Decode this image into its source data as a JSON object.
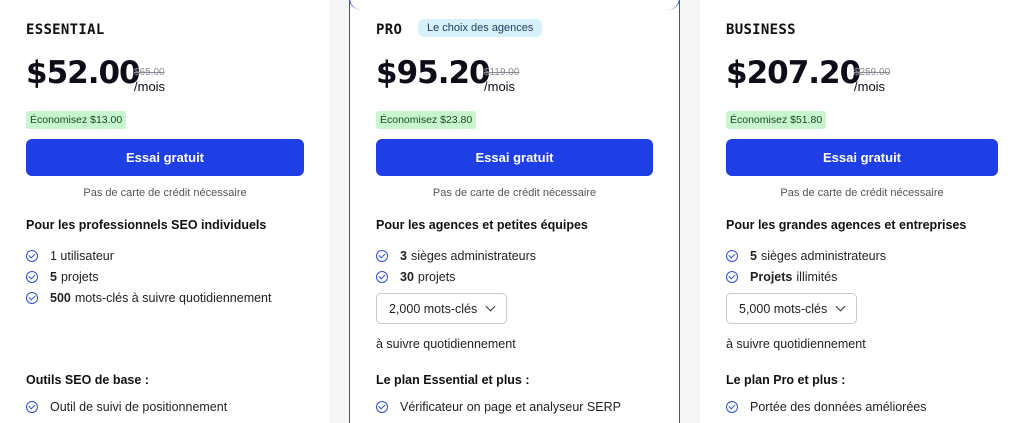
{
  "colors": {
    "accent": "#1f3fe6",
    "save_bg": "#c9f5cf",
    "badge_bg": "#d6f1fb",
    "check": "#2b4fd7"
  },
  "plans": [
    {
      "name": "ESSENTIAL",
      "price": "$52.00",
      "old_price": "$65.00",
      "per": "/mois",
      "save": "Économisez $13.00",
      "cta": "Essai gratuit",
      "no_card": "Pas de carte de crédit nécessaire",
      "audience": "Pour les professionnels SEO individuels",
      "features": [
        {
          "bold": "",
          "text": "1 utilisateur"
        },
        {
          "bold": "5",
          "text": "projets"
        },
        {
          "bold": "500",
          "text": "mots-clés à suivre quotidiennement"
        }
      ],
      "section_title": "Outils SEO de base :",
      "tools": [
        "Outil de suivi de positionnement"
      ]
    },
    {
      "name": "PRO",
      "badge": "Le choix des agences",
      "price": "$95.20",
      "old_price": "$119.00",
      "per": "/mois",
      "save": "Économisez $23.80",
      "cta": "Essai gratuit",
      "no_card": "Pas de carte de crédit nécessaire",
      "audience": "Pour les agences et petites équipes",
      "features": [
        {
          "bold": "3",
          "text": "sièges administrateurs"
        },
        {
          "bold": "30",
          "text": "projets"
        }
      ],
      "keywords_select": "2,000 mots-clés",
      "daily": "à suivre quotidiennement",
      "section_title": "Le plan Essential et plus :",
      "tools": [
        "Vérificateur on page et analyseur SERP"
      ]
    },
    {
      "name": "BUSINESS",
      "price": "$207.20",
      "old_price": "$259.00",
      "per": "/mois",
      "save": "Économisez $51.80",
      "cta": "Essai gratuit",
      "no_card": "Pas de carte de crédit nécessaire",
      "audience": "Pour les grandes agences et entreprises",
      "features": [
        {
          "bold": "5",
          "text": "sièges administrateurs"
        },
        {
          "bold": "Projets",
          "text": "illimités"
        }
      ],
      "keywords_select": "5,000 mots-clés",
      "daily": "à suivre quotidiennement",
      "section_title": "Le plan Pro et plus :",
      "tools": [
        "Portée des données améliorées"
      ]
    }
  ]
}
